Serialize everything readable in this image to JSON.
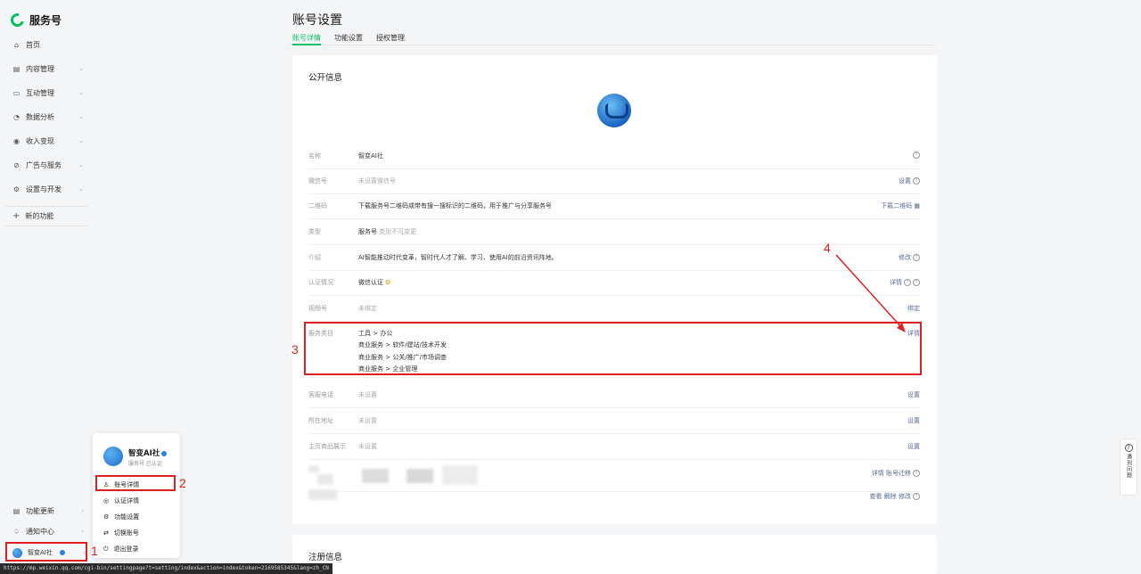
{
  "brand": {
    "name": "服务号"
  },
  "sidebar": {
    "items": [
      {
        "label": "首页",
        "icon": "home-icon"
      },
      {
        "label": "内容管理",
        "icon": "document-icon"
      },
      {
        "label": "互动管理",
        "icon": "chat-icon"
      },
      {
        "label": "数据分析",
        "icon": "chart-icon"
      },
      {
        "label": "收入变现",
        "icon": "money-icon"
      },
      {
        "label": "广告与服务",
        "icon": "ad-icon"
      },
      {
        "label": "设置与开发",
        "icon": "gear-icon"
      }
    ],
    "new_func": "新的功能",
    "bottom": [
      {
        "label": "功能更新",
        "icon": "update-icon"
      },
      {
        "label": "通知中心",
        "icon": "bell-icon"
      }
    ],
    "account": {
      "name": "智变AI社"
    }
  },
  "popup": {
    "name": "智变AI社",
    "sub": "服务号  已认证",
    "items": [
      {
        "label": "账号详情",
        "icon": "user-icon"
      },
      {
        "label": "认证详情",
        "icon": "check-circle-icon"
      },
      {
        "label": "功能设置",
        "icon": "gear-icon"
      },
      {
        "label": "切换账号",
        "icon": "switch-icon"
      },
      {
        "label": "退出登录",
        "icon": "power-icon"
      }
    ]
  },
  "page": {
    "title": "账号设置",
    "tabs": [
      "账号详情",
      "功能设置",
      "授权管理"
    ]
  },
  "public_info": {
    "title": "公开信息",
    "rows": {
      "name": {
        "label": "名称",
        "value": "智变AI社"
      },
      "wechat_id": {
        "label": "微信号",
        "value": "未设置微信号",
        "action": "设置"
      },
      "qrcode": {
        "label": "二维码",
        "value": "下载服务号二维码或带有搜一搜标识的二维码，用于推广与分享服务号",
        "action": "下载二维码"
      },
      "type": {
        "label": "类型",
        "value": "服务号",
        "value_note": "类型不可变更"
      },
      "intro": {
        "label": "介绍",
        "value": "AI智能推动时代变革，智时代人才了解、学习、使用AI的前沿资讯阵地。",
        "action": "修改"
      },
      "verify": {
        "label": "认证情况",
        "value": "微信认证",
        "action": "详情"
      },
      "mini": {
        "label": "视频号",
        "value": "未绑定",
        "action": "绑定"
      },
      "category": {
        "label": "服务类目",
        "values": [
          "工具 > 办公",
          "商业服务 > 软件/建站/技术开发",
          "商业服务 > 公关/推广/市场调查",
          "商业服务 > 企业管理"
        ],
        "action": "详情"
      },
      "phone": {
        "label": "客服电话",
        "value": "未设置",
        "action": "设置"
      },
      "location": {
        "label": "所在地址",
        "value": "未设置",
        "action": "设置"
      },
      "home_show": {
        "label": "主页商品展示",
        "value": "未设置",
        "action": "设置"
      },
      "extra1": {
        "action": "详情 账号迁移"
      },
      "extra2": {
        "action": "查看 解除 修改"
      }
    }
  },
  "register_info": {
    "title": "注册信息"
  },
  "help": {
    "text": "遇到问题"
  },
  "annotations": {
    "one": "1",
    "two": "2",
    "three": "3",
    "four": "4"
  },
  "status_url": "https://mp.weixin.qq.com/cgi-bin/settingpage?t=setting/index&action=index&token=2169585345&lang=zh_CN"
}
